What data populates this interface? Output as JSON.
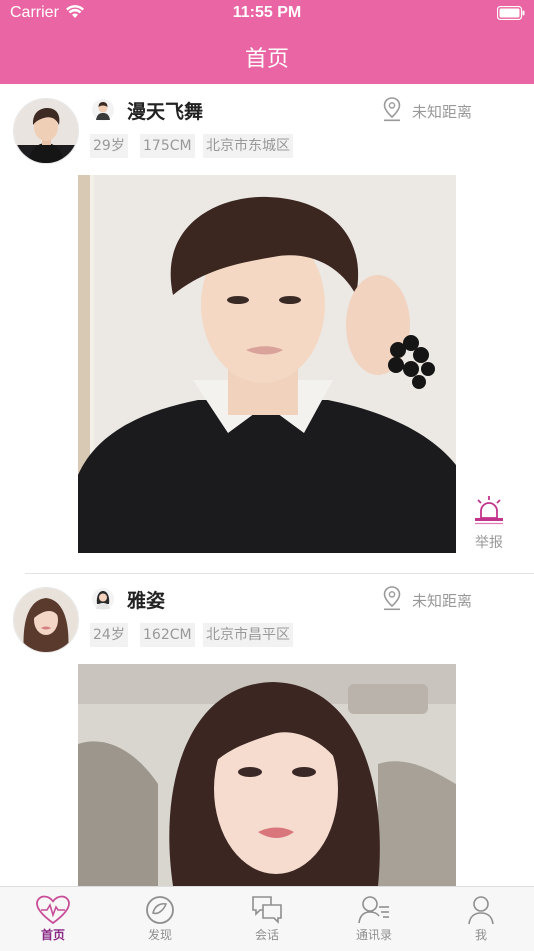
{
  "status_bar": {
    "carrier": "Carrier",
    "time": "11:55 PM",
    "icons": [
      "wifi-icon",
      "battery-icon"
    ]
  },
  "nav": {
    "title": "首页"
  },
  "feed": [
    {
      "name": "漫天飞舞",
      "gender_icon": "male-avatar-icon",
      "distance": "未知距离",
      "tags": [
        "29岁",
        "175CM",
        "北京市东城区"
      ],
      "photo_icon": "profile-photo",
      "report_label": "举报"
    },
    {
      "name": "雅姿",
      "gender_icon": "female-avatar-icon",
      "distance": "未知距离",
      "tags": [
        "24岁",
        "162CM",
        "北京市昌平区"
      ],
      "photo_icon": "profile-photo"
    }
  ],
  "tabs": [
    {
      "label": "首页",
      "icon": "heart-pulse-icon",
      "active": true
    },
    {
      "label": "发现",
      "icon": "compass-icon",
      "active": false
    },
    {
      "label": "会话",
      "icon": "chat-icon",
      "active": false
    },
    {
      "label": "通讯录",
      "icon": "contacts-icon",
      "active": false
    },
    {
      "label": "我",
      "icon": "person-icon",
      "active": false
    }
  ],
  "colors": {
    "accent": "#ea65a3",
    "active_tab": "#8a2a86",
    "muted_text": "#999999",
    "tag_bg": "#f2f2f2"
  }
}
